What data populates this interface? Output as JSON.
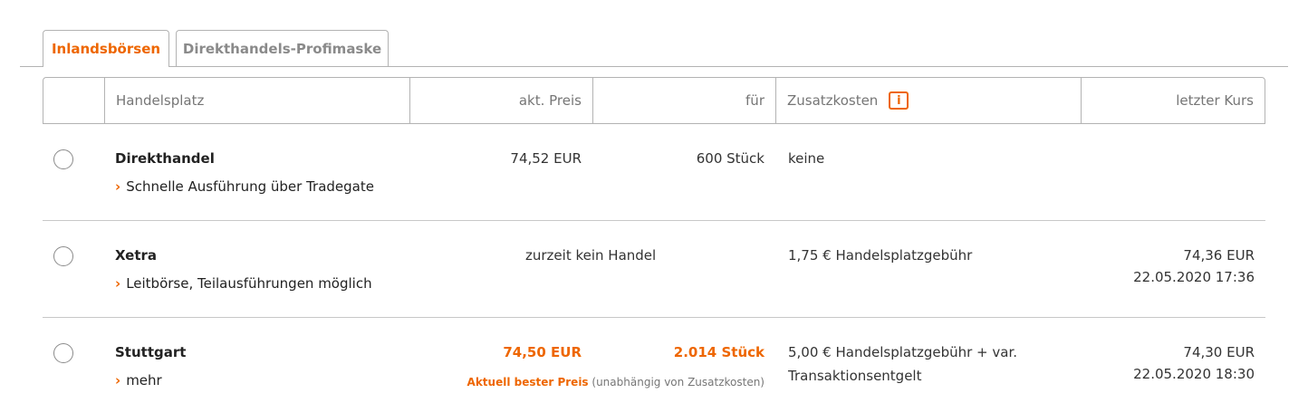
{
  "tabs": [
    {
      "label": "Inlandsbörsen",
      "active": true
    },
    {
      "label": "Direkthandels-Profimaske",
      "active": false
    }
  ],
  "table": {
    "headers": {
      "handelsplatz": "Handelsplatz",
      "preis": "akt. Preis",
      "fuer": "für",
      "zusatzkosten": "Zusatzkosten",
      "info_icon": "i",
      "letzter_kurs": "letzter Kurs"
    },
    "rows": [
      {
        "name": "Direkthandel",
        "sub": "Schnelle Ausführung über Tradegate",
        "price": "74,52 EUR",
        "qty": "600 Stück",
        "costs": "keine"
      },
      {
        "name": "Xetra",
        "sub": "Leitbörse, Teilausführungen möglich",
        "status": "zurzeit kein Handel",
        "costs": "1,75 € Handelsplatzgebühr",
        "last_price": "74,36 EUR",
        "last_time": "22.05.2020 17:36"
      },
      {
        "name": "Stuttgart",
        "sub": "mehr",
        "price": "74,50 EUR",
        "qty": "2.014 Stück",
        "best_label": "Aktuell bester Preis",
        "best_note": " (unabhängig von Zusatzkosten)",
        "costs": "5,00 € Handelsplatzgebühr + var.",
        "costs_line2": "Transaktionsentgelt",
        "last_price": "74,30 EUR",
        "last_time": "22.05.2020 18:30"
      }
    ]
  },
  "colors": {
    "accent": "#ee6600",
    "border": "#b3b3b3",
    "text": "#333333",
    "muted": "#767676"
  },
  "icons": {
    "chevron": "chevron-right-icon",
    "info": "info-icon",
    "radio": "radio-button"
  }
}
